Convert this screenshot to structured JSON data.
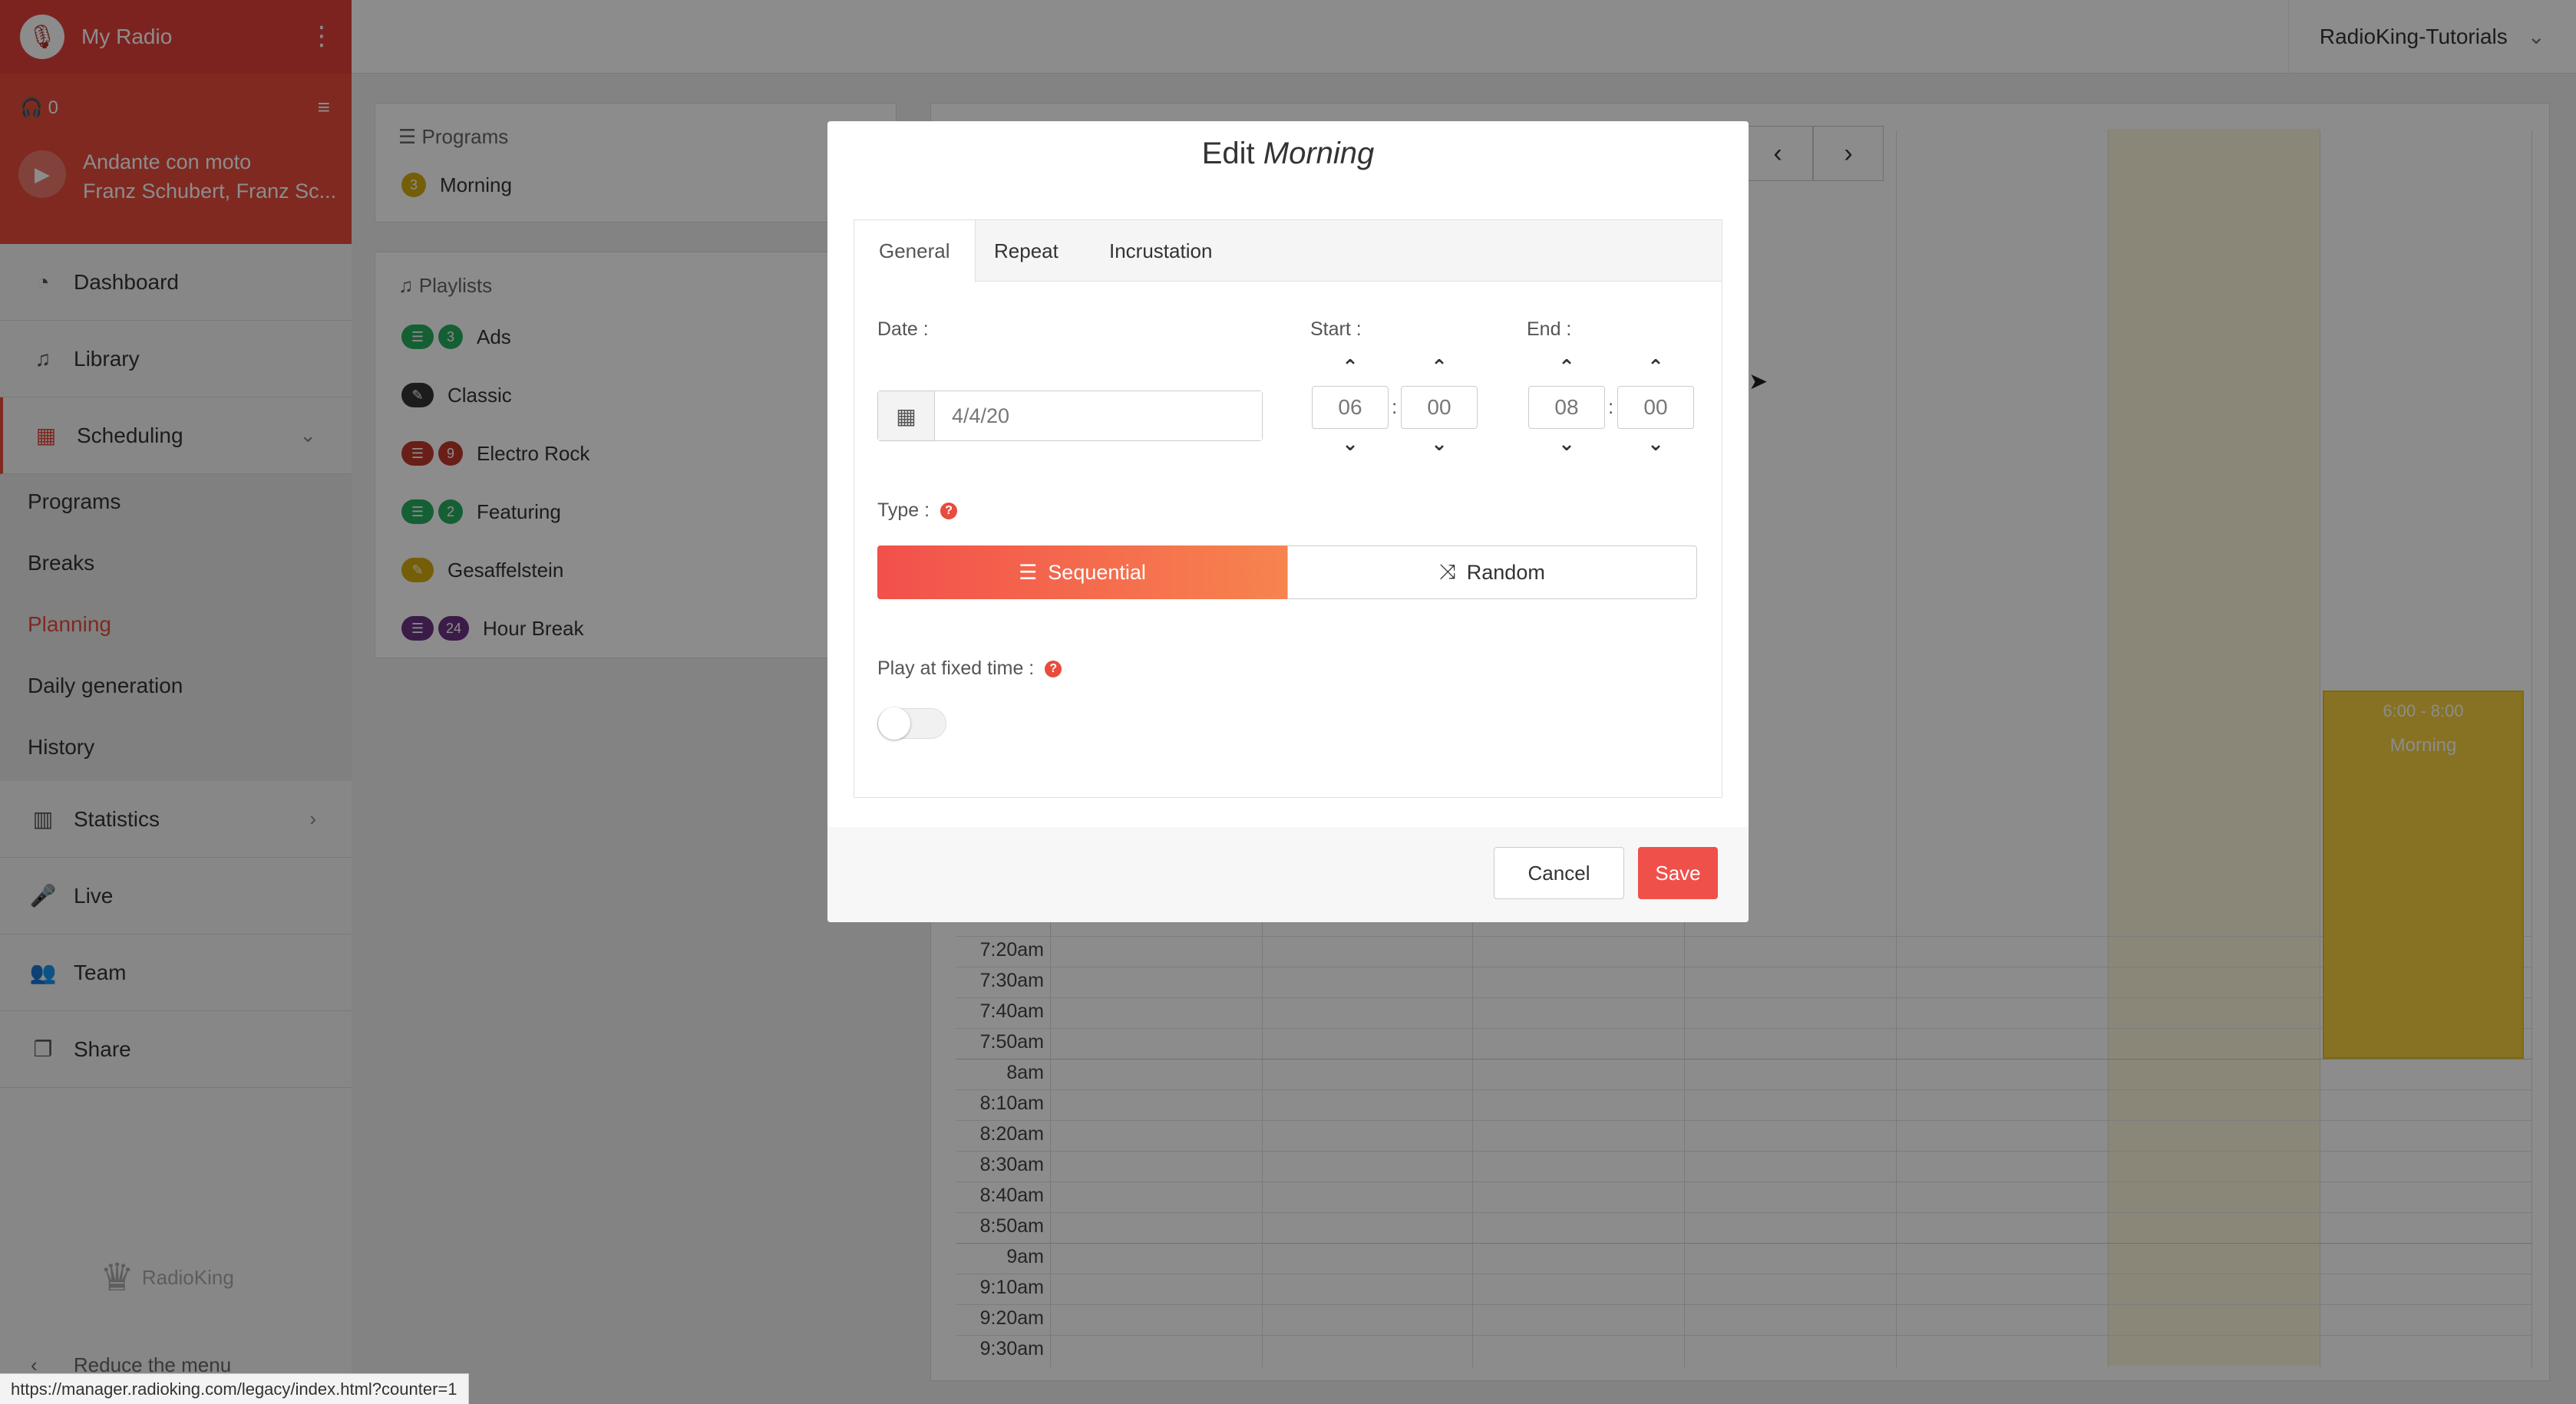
{
  "sidebar": {
    "radio_name": "My Radio",
    "listeners": "0",
    "track_title": "Andante con moto",
    "track_artist": "Franz Schubert, Franz Sc...",
    "nav": {
      "dashboard": "Dashboard",
      "library": "Library",
      "scheduling": "Scheduling",
      "statistics": "Statistics",
      "live": "Live",
      "team": "Team",
      "share": "Share"
    },
    "scheduling_sub": [
      "Programs",
      "Breaks",
      "Planning",
      "Daily generation",
      "History"
    ],
    "active_sub": "Planning",
    "brand": "RadioKing",
    "reduce_menu": "Reduce the menu"
  },
  "topbar": {
    "account": "RadioKing-Tutorials"
  },
  "programs_panel": {
    "title": "Programs",
    "items": [
      {
        "count": "3",
        "name": "Morning",
        "color": "#d4ac0d"
      }
    ]
  },
  "playlists_panel": {
    "title": "Playlists",
    "items": [
      {
        "count": "3",
        "name": "Ads",
        "color": "#27ae60"
      },
      {
        "count": "",
        "name": "Classic",
        "color": "#333333"
      },
      {
        "count": "9",
        "name": "Electro Rock",
        "color": "#c0392b"
      },
      {
        "count": "2",
        "name": "Featuring",
        "color": "#27ae60"
      },
      {
        "count": "",
        "name": "Gesaffelstein",
        "color": "#d4ac0d"
      },
      {
        "count": "24",
        "name": "Hour Break",
        "color": "#6c3483"
      }
    ]
  },
  "calendar": {
    "times": [
      "7:20am",
      "7:30am",
      "7:40am",
      "7:50am",
      "8am",
      "8:10am",
      "8:20am",
      "8:30am",
      "8:40am",
      "8:50am",
      "9am",
      "9:10am",
      "9:20am",
      "9:30am"
    ],
    "event": {
      "time": "6:00 - 8:00",
      "name": "Morning",
      "color": "#f4d03f"
    }
  },
  "modal": {
    "title_prefix": "Edit ",
    "title_name": "Morning",
    "tabs": [
      "General",
      "Repeat",
      "Incrustation"
    ],
    "active_tab": "General",
    "date_label": "Date :",
    "date_value": "4/4/20",
    "start_label": "Start :",
    "end_label": "End :",
    "start_hour": "06",
    "start_min": "00",
    "end_hour": "08",
    "end_min": "00",
    "type_label": "Type :",
    "type_sequential": "Sequential",
    "type_random": "Random",
    "selected_type": "Sequential",
    "fixed_time_label": "Play at fixed time :",
    "fixed_time_enabled": false,
    "cancel": "Cancel",
    "save": "Save",
    "accent": "#f0504a"
  },
  "status_url": "https://manager.radioking.com/legacy/index.html?counter=1"
}
